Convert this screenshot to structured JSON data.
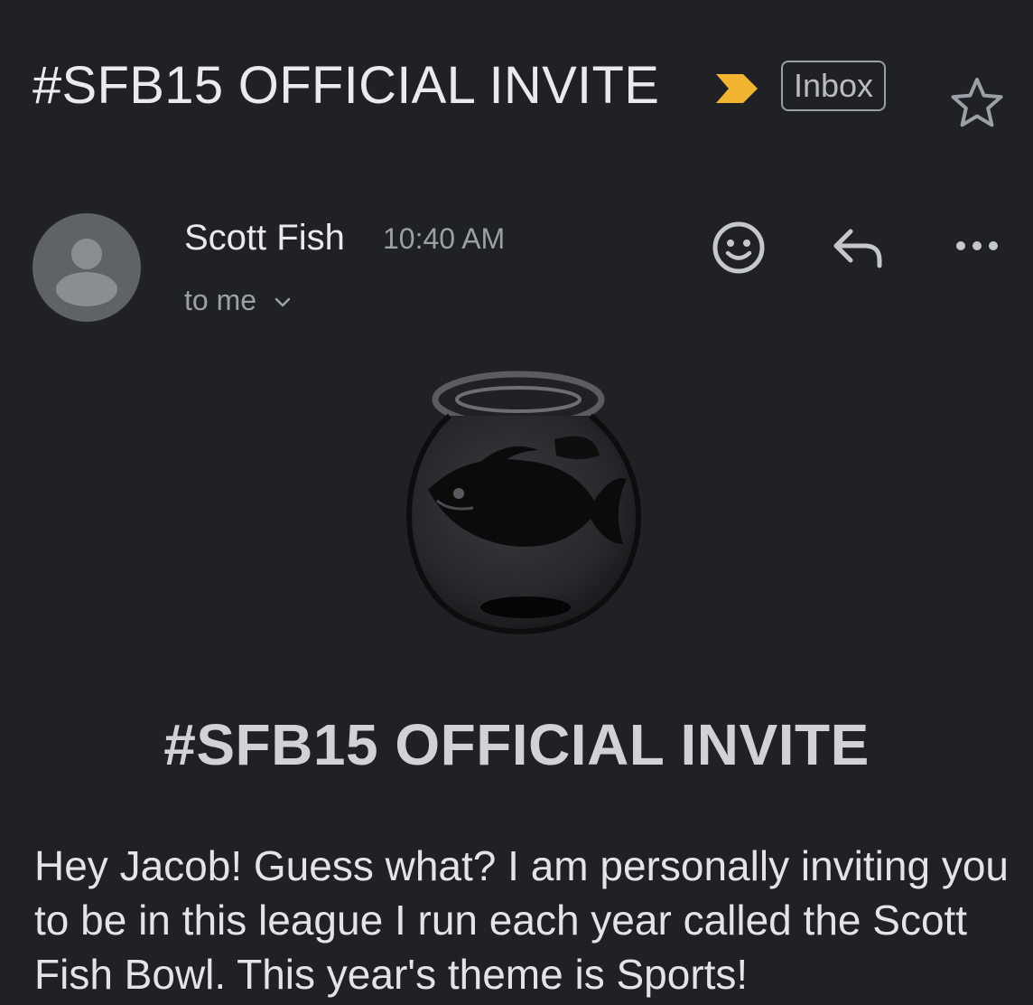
{
  "email": {
    "subject": "#SFB15 OFFICIAL INVITE",
    "label": "Inbox",
    "importance_color": "#f2b532"
  },
  "sender": {
    "name": "Scott Fish",
    "time": "10:40 AM",
    "recipient": "to me"
  },
  "icons": {
    "importance": "importance-marker-icon",
    "star": "star-icon",
    "avatar": "person-icon",
    "emoji": "smiley-icon",
    "reply": "reply-icon",
    "more": "more-horizontal-icon",
    "expand": "chevron-down-icon",
    "hero": "fishbowl-logo"
  },
  "message": {
    "heading": "#SFB15 OFFICIAL INVITE",
    "body": "Hey Jacob! Guess what? I am personally inviting you to be in this league I run each year called the Scott Fish Bowl. This year's theme is Sports!"
  }
}
